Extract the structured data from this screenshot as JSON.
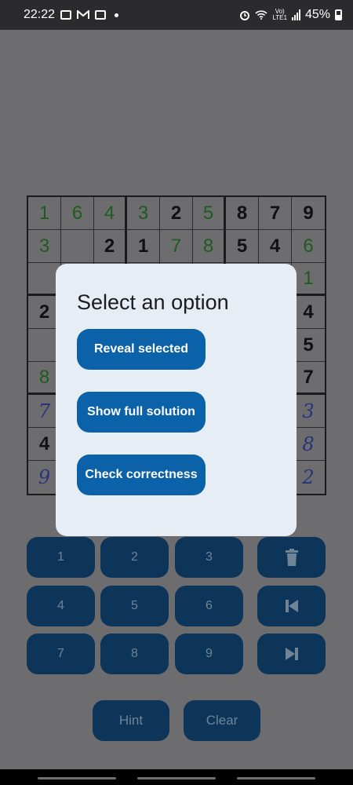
{
  "status_bar": {
    "time": "22:22",
    "volte": "Vo)\nLTE1",
    "battery": "45%",
    "left_icons": [
      "image-icon",
      "gmail-icon",
      "mail-icon",
      "notification-dot"
    ],
    "right_icons": [
      "alarm-icon",
      "wifi-icon",
      "volte-icon",
      "signal-icon",
      "battery-icon"
    ]
  },
  "board": {
    "rows": [
      [
        {
          "v": "1",
          "t": "user"
        },
        {
          "v": "6",
          "t": "user"
        },
        {
          "v": "4",
          "t": "user"
        },
        {
          "v": "3",
          "t": "user"
        },
        {
          "v": "2",
          "t": "given"
        },
        {
          "v": "5",
          "t": "user"
        },
        {
          "v": "8",
          "t": "given"
        },
        {
          "v": "7",
          "t": "given"
        },
        {
          "v": "9",
          "t": "given"
        }
      ],
      [
        {
          "v": "3",
          "t": "user"
        },
        {
          "v": "",
          "t": "empty"
        },
        {
          "v": "2",
          "t": "given"
        },
        {
          "v": "1",
          "t": "given"
        },
        {
          "v": "7",
          "t": "user"
        },
        {
          "v": "8",
          "t": "user"
        },
        {
          "v": "5",
          "t": "given"
        },
        {
          "v": "4",
          "t": "given"
        },
        {
          "v": "6",
          "t": "user"
        }
      ],
      [
        {
          "v": "",
          "t": "empty"
        },
        {
          "v": "",
          "t": "empty"
        },
        {
          "v": "",
          "t": "empty"
        },
        {
          "v": "",
          "t": "empty"
        },
        {
          "v": "",
          "t": "empty"
        },
        {
          "v": "",
          "t": "empty"
        },
        {
          "v": "",
          "t": "empty"
        },
        {
          "v": "",
          "t": "empty"
        },
        {
          "v": "1",
          "t": "user"
        }
      ],
      [
        {
          "v": "2",
          "t": "given"
        },
        {
          "v": "",
          "t": "empty"
        },
        {
          "v": "",
          "t": "empty"
        },
        {
          "v": "",
          "t": "empty"
        },
        {
          "v": "",
          "t": "empty"
        },
        {
          "v": "",
          "t": "empty"
        },
        {
          "v": "",
          "t": "empty"
        },
        {
          "v": "",
          "t": "empty"
        },
        {
          "v": "4",
          "t": "given"
        }
      ],
      [
        {
          "v": "",
          "t": "empty"
        },
        {
          "v": "",
          "t": "empty"
        },
        {
          "v": "",
          "t": "empty"
        },
        {
          "v": "",
          "t": "empty"
        },
        {
          "v": "",
          "t": "empty"
        },
        {
          "v": "",
          "t": "empty"
        },
        {
          "v": "",
          "t": "empty"
        },
        {
          "v": "",
          "t": "empty"
        },
        {
          "v": "5",
          "t": "given"
        }
      ],
      [
        {
          "v": "8",
          "t": "user"
        },
        {
          "v": "",
          "t": "empty"
        },
        {
          "v": "",
          "t": "empty"
        },
        {
          "v": "",
          "t": "empty"
        },
        {
          "v": "",
          "t": "empty"
        },
        {
          "v": "",
          "t": "empty"
        },
        {
          "v": "",
          "t": "empty"
        },
        {
          "v": "",
          "t": "empty"
        },
        {
          "v": "7",
          "t": "given"
        }
      ],
      [
        {
          "v": "7",
          "t": "sol"
        },
        {
          "v": "",
          "t": "empty"
        },
        {
          "v": "",
          "t": "empty"
        },
        {
          "v": "",
          "t": "empty"
        },
        {
          "v": "",
          "t": "empty"
        },
        {
          "v": "",
          "t": "empty"
        },
        {
          "v": "",
          "t": "empty"
        },
        {
          "v": "",
          "t": "empty"
        },
        {
          "v": "3",
          "t": "sol"
        }
      ],
      [
        {
          "v": "4",
          "t": "given"
        },
        {
          "v": "",
          "t": "empty"
        },
        {
          "v": "",
          "t": "empty"
        },
        {
          "v": "",
          "t": "empty"
        },
        {
          "v": "",
          "t": "empty"
        },
        {
          "v": "",
          "t": "empty"
        },
        {
          "v": "",
          "t": "empty"
        },
        {
          "v": "",
          "t": "empty"
        },
        {
          "v": "8",
          "t": "sol"
        }
      ],
      [
        {
          "v": "9",
          "t": "sol"
        },
        {
          "v": "",
          "t": "empty"
        },
        {
          "v": "",
          "t": "empty"
        },
        {
          "v": "",
          "t": "empty"
        },
        {
          "v": "",
          "t": "empty"
        },
        {
          "v": "",
          "t": "empty"
        },
        {
          "v": "",
          "t": "empty"
        },
        {
          "v": "",
          "t": "empty"
        },
        {
          "v": "2",
          "t": "sol"
        }
      ]
    ]
  },
  "keypad": {
    "numbers": [
      "1",
      "2",
      "3",
      "4",
      "5",
      "6",
      "7",
      "8",
      "9"
    ],
    "actions": [
      "trash-icon",
      "previous-icon",
      "next-icon"
    ],
    "hint_label": "Hint",
    "clear_label": "Clear"
  },
  "dialog": {
    "title": "Select an option",
    "reveal_label": "Reveal selected",
    "solution_label": "Show full solution",
    "check_label": "Check correctness"
  },
  "colors": {
    "accent": "#0c62a8",
    "keypad_dimmed": "#0c3559",
    "dialog_background": "#e6edf5",
    "user_digit": "#1f5a1f",
    "solution_digit": "#26347a"
  }
}
